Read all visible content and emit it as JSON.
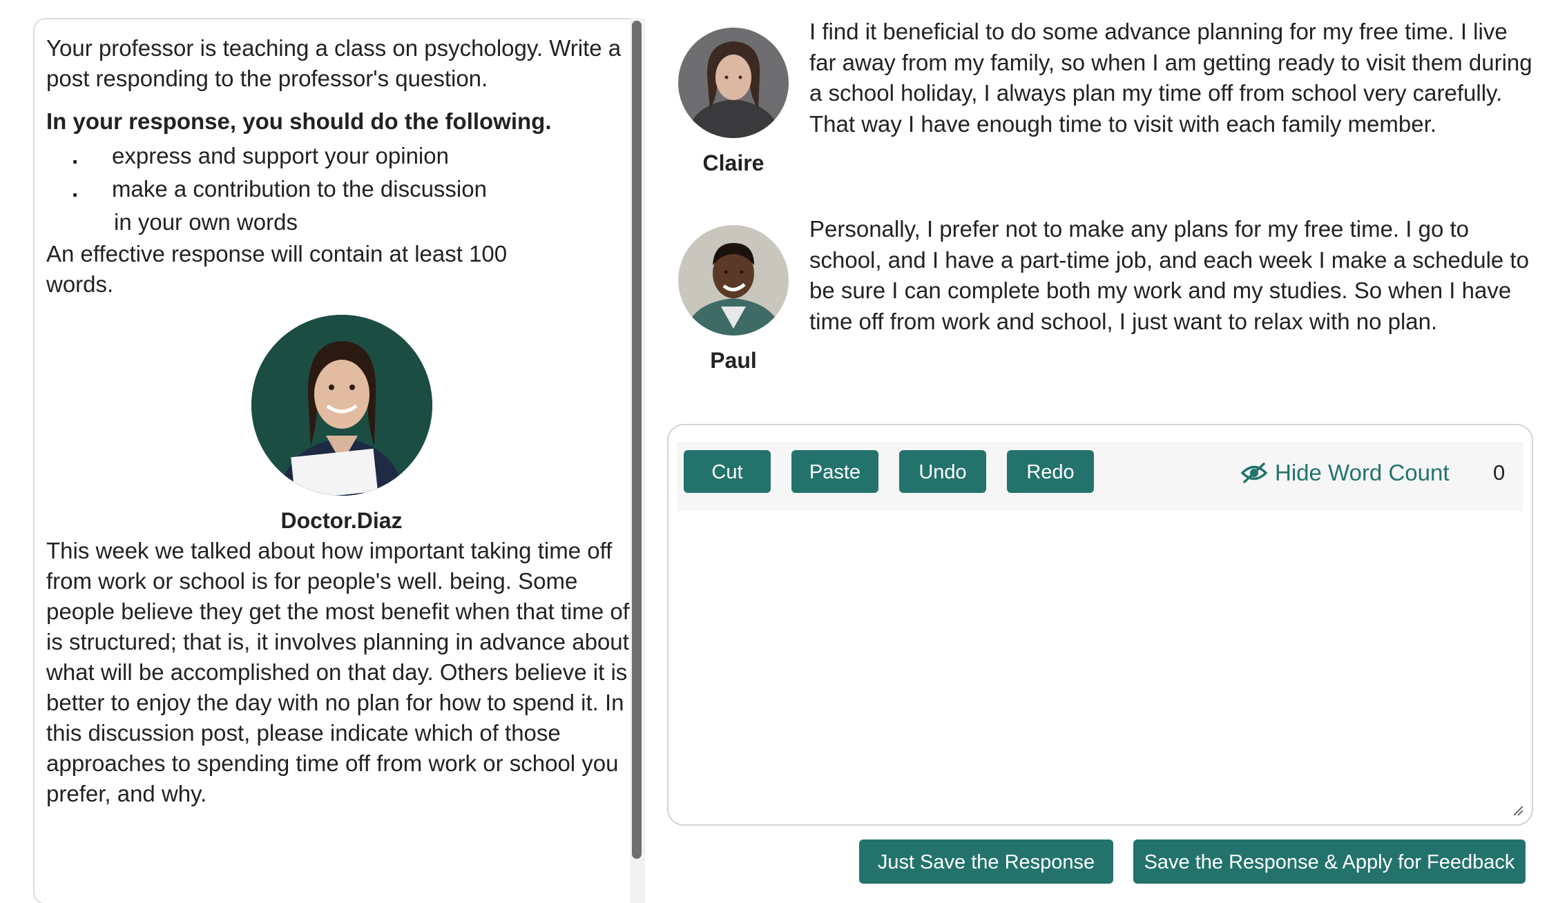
{
  "prompt": {
    "intro": "Your professor is teaching a class on psychology. Write a post responding to the professor's question.",
    "directions_heading": "In your response, you should do the following.",
    "bullets": [
      "express and support your opinion",
      "make a contribution to the discussion"
    ],
    "bullet_continuation": "in your own words",
    "requirement": "An effective response will contain at least 100 words.",
    "bullet_marker": "."
  },
  "professor": {
    "name": "Doctor.Diaz",
    "question": "This week we talked about how important taking time off from work or school is for people's well. being. Some people believe they get the most benefit when that time off is structured; that is, it involves planning in advance about what will be accomplished on that day. Others believe it is better to enjoy the day with no plan for how to spend it. In this discussion post, please indicate which of those approaches to spending time off from work or school you prefer, and why."
  },
  "students": [
    {
      "name": "Claire",
      "post": "I find it beneficial to do some advance planning for my free time. I live far away from my family, so when I am getting ready to visit them during a school holiday, I always plan my time off from school very carefully. That way I have enough time to visit with each family member."
    },
    {
      "name": "Paul",
      "post": "Personally, I prefer not to make any plans for my free time. I go to school, and I have a part-time job, and each week I make a schedule to be sure I can complete both my work and my studies. So when I have time off from work and school, I just want to relax with no plan."
    }
  ],
  "editor": {
    "buttons": {
      "cut": "Cut",
      "paste": "Paste",
      "undo": "Undo",
      "redo": "Redo"
    },
    "word_count_toggle": "Hide Word Count",
    "word_count_icon": "eye-slash-icon",
    "word_count": "0",
    "response_value": ""
  },
  "actions": {
    "save": "Just Save the Response",
    "save_feedback": "Save the Response & Apply for Feedback"
  },
  "colors": {
    "accent": "#23736c",
    "text": "#222222",
    "border": "#dcdcdc"
  }
}
